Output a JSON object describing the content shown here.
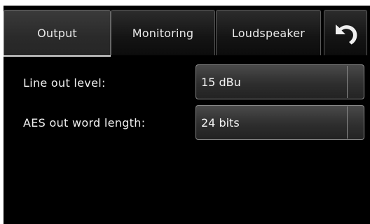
{
  "tabs": [
    {
      "label": "Output",
      "active": true
    },
    {
      "label": "Monitoring",
      "active": false
    },
    {
      "label": "Loudspeaker",
      "active": false
    }
  ],
  "undo": {
    "icon": "undo-arrow-icon"
  },
  "settings": [
    {
      "label": "Line out level:",
      "value": "15 dBu"
    },
    {
      "label": "AES out word length:",
      "value": "24 bits"
    }
  ],
  "colors": {
    "background": "#000000",
    "text": "#f0f0f0",
    "control_border": "#8a8a8a",
    "active_tab_underline": "#d9d9d9"
  }
}
